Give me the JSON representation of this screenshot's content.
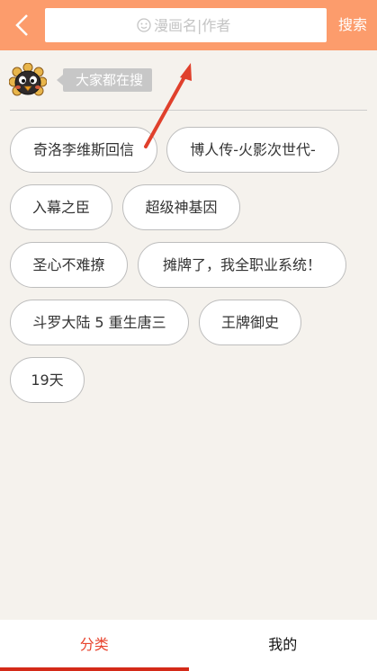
{
  "header": {
    "search_placeholder": "漫画名|作者",
    "search_button": "搜索",
    "accent_color": "#fc9c6c"
  },
  "hot": {
    "label": "大家都在搜",
    "tags": [
      "奇洛李维斯回信",
      "博人传-火影次世代-",
      "入幕之臣",
      "超级神基因",
      "圣心不难撩",
      "摊牌了，我全职业系统！",
      "斗罗大陆 5 重生唐三",
      "王牌御史",
      "19天"
    ]
  },
  "bottom_nav": {
    "tabs": [
      {
        "label": "分类",
        "active": true
      },
      {
        "label": "我的",
        "active": false
      }
    ],
    "active_color": "#e8442e"
  },
  "icons": {
    "back": "chevron-left-icon",
    "search_face": "smiley-icon",
    "mascot": "sunflower-mascot-icon"
  }
}
